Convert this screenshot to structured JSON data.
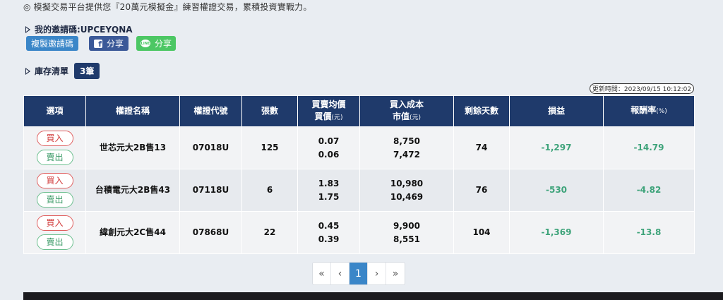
{
  "notice": "◎ 模擬交易平台提供您『20萬元模擬金』練習權證交易，累積投資實戰力。",
  "invite": {
    "label": "我的邀請碼:UPCEYQNA",
    "copy_button": "複製邀請碼",
    "fb_share": "分享",
    "line_share": "分享",
    "fb_icon": "f",
    "line_icon": "LINE"
  },
  "inventory": {
    "label": "庫存清單",
    "count": "3筆"
  },
  "update_time": "更新時間：2023/09/15 10:12:02",
  "table": {
    "headers": {
      "options": "選項",
      "name": "權證名稱",
      "code": "權證代號",
      "shares": "張數",
      "avg_price_1": "買賣均價",
      "avg_price_2": "買價",
      "avg_price_unit": "(元)",
      "cost_1": "買入成本",
      "cost_2": "市值",
      "cost_unit": "(元)",
      "days": "剩餘天數",
      "pnl": "損益",
      "roi": "報酬率",
      "roi_unit": "(%)"
    },
    "buy_label": "買入",
    "sell_label": "賣出",
    "rows": [
      {
        "name": "世芯元大2B售13",
        "code": "07018U",
        "shares": "125",
        "buy_price": "0.07",
        "sell_price": "0.06",
        "cost": "8,750",
        "market_value": "7,472",
        "days": "74",
        "pnl": "-1,297",
        "roi": "-14.79"
      },
      {
        "name": "台積電元大2B售43",
        "code": "07118U",
        "shares": "6",
        "buy_price": "1.83",
        "sell_price": "1.75",
        "cost": "10,980",
        "market_value": "10,469",
        "days": "76",
        "pnl": "-530",
        "roi": "-4.82"
      },
      {
        "name": "緯創元大2C售44",
        "code": "07868U",
        "shares": "22",
        "buy_price": "0.45",
        "sell_price": "0.39",
        "cost": "9,900",
        "market_value": "8,551",
        "days": "104",
        "pnl": "-1,369",
        "roi": "-13.8"
      }
    ]
  },
  "pagination": {
    "first": "«",
    "prev": "‹",
    "current": "1",
    "next": "›",
    "last": "»"
  },
  "colors": {
    "header_bg": "#1f3a6b",
    "accent_blue": "#3a86c8",
    "loss_green": "#3ea37a",
    "buy_red": "#d23c3c"
  }
}
